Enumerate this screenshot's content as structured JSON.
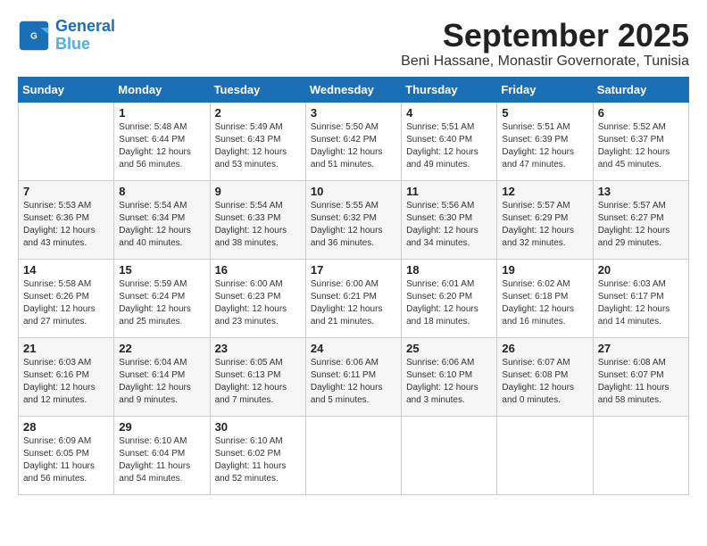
{
  "logo": {
    "line1": "General",
    "line2": "Blue"
  },
  "title": "September 2025",
  "location": "Beni Hassane, Monastir Governorate, Tunisia",
  "days_of_week": [
    "Sunday",
    "Monday",
    "Tuesday",
    "Wednesday",
    "Thursday",
    "Friday",
    "Saturday"
  ],
  "weeks": [
    [
      {
        "day": "",
        "text": ""
      },
      {
        "day": "1",
        "text": "Sunrise: 5:48 AM\nSunset: 6:44 PM\nDaylight: 12 hours\nand 56 minutes."
      },
      {
        "day": "2",
        "text": "Sunrise: 5:49 AM\nSunset: 6:43 PM\nDaylight: 12 hours\nand 53 minutes."
      },
      {
        "day": "3",
        "text": "Sunrise: 5:50 AM\nSunset: 6:42 PM\nDaylight: 12 hours\nand 51 minutes."
      },
      {
        "day": "4",
        "text": "Sunrise: 5:51 AM\nSunset: 6:40 PM\nDaylight: 12 hours\nand 49 minutes."
      },
      {
        "day": "5",
        "text": "Sunrise: 5:51 AM\nSunset: 6:39 PM\nDaylight: 12 hours\nand 47 minutes."
      },
      {
        "day": "6",
        "text": "Sunrise: 5:52 AM\nSunset: 6:37 PM\nDaylight: 12 hours\nand 45 minutes."
      }
    ],
    [
      {
        "day": "7",
        "text": "Sunrise: 5:53 AM\nSunset: 6:36 PM\nDaylight: 12 hours\nand 43 minutes."
      },
      {
        "day": "8",
        "text": "Sunrise: 5:54 AM\nSunset: 6:34 PM\nDaylight: 12 hours\nand 40 minutes."
      },
      {
        "day": "9",
        "text": "Sunrise: 5:54 AM\nSunset: 6:33 PM\nDaylight: 12 hours\nand 38 minutes."
      },
      {
        "day": "10",
        "text": "Sunrise: 5:55 AM\nSunset: 6:32 PM\nDaylight: 12 hours\nand 36 minutes."
      },
      {
        "day": "11",
        "text": "Sunrise: 5:56 AM\nSunset: 6:30 PM\nDaylight: 12 hours\nand 34 minutes."
      },
      {
        "day": "12",
        "text": "Sunrise: 5:57 AM\nSunset: 6:29 PM\nDaylight: 12 hours\nand 32 minutes."
      },
      {
        "day": "13",
        "text": "Sunrise: 5:57 AM\nSunset: 6:27 PM\nDaylight: 12 hours\nand 29 minutes."
      }
    ],
    [
      {
        "day": "14",
        "text": "Sunrise: 5:58 AM\nSunset: 6:26 PM\nDaylight: 12 hours\nand 27 minutes."
      },
      {
        "day": "15",
        "text": "Sunrise: 5:59 AM\nSunset: 6:24 PM\nDaylight: 12 hours\nand 25 minutes."
      },
      {
        "day": "16",
        "text": "Sunrise: 6:00 AM\nSunset: 6:23 PM\nDaylight: 12 hours\nand 23 minutes."
      },
      {
        "day": "17",
        "text": "Sunrise: 6:00 AM\nSunset: 6:21 PM\nDaylight: 12 hours\nand 21 minutes."
      },
      {
        "day": "18",
        "text": "Sunrise: 6:01 AM\nSunset: 6:20 PM\nDaylight: 12 hours\nand 18 minutes."
      },
      {
        "day": "19",
        "text": "Sunrise: 6:02 AM\nSunset: 6:18 PM\nDaylight: 12 hours\nand 16 minutes."
      },
      {
        "day": "20",
        "text": "Sunrise: 6:03 AM\nSunset: 6:17 PM\nDaylight: 12 hours\nand 14 minutes."
      }
    ],
    [
      {
        "day": "21",
        "text": "Sunrise: 6:03 AM\nSunset: 6:16 PM\nDaylight: 12 hours\nand 12 minutes."
      },
      {
        "day": "22",
        "text": "Sunrise: 6:04 AM\nSunset: 6:14 PM\nDaylight: 12 hours\nand 9 minutes."
      },
      {
        "day": "23",
        "text": "Sunrise: 6:05 AM\nSunset: 6:13 PM\nDaylight: 12 hours\nand 7 minutes."
      },
      {
        "day": "24",
        "text": "Sunrise: 6:06 AM\nSunset: 6:11 PM\nDaylight: 12 hours\nand 5 minutes."
      },
      {
        "day": "25",
        "text": "Sunrise: 6:06 AM\nSunset: 6:10 PM\nDaylight: 12 hours\nand 3 minutes."
      },
      {
        "day": "26",
        "text": "Sunrise: 6:07 AM\nSunset: 6:08 PM\nDaylight: 12 hours\nand 0 minutes."
      },
      {
        "day": "27",
        "text": "Sunrise: 6:08 AM\nSunset: 6:07 PM\nDaylight: 11 hours\nand 58 minutes."
      }
    ],
    [
      {
        "day": "28",
        "text": "Sunrise: 6:09 AM\nSunset: 6:05 PM\nDaylight: 11 hours\nand 56 minutes."
      },
      {
        "day": "29",
        "text": "Sunrise: 6:10 AM\nSunset: 6:04 PM\nDaylight: 11 hours\nand 54 minutes."
      },
      {
        "day": "30",
        "text": "Sunrise: 6:10 AM\nSunset: 6:02 PM\nDaylight: 11 hours\nand 52 minutes."
      },
      {
        "day": "",
        "text": ""
      },
      {
        "day": "",
        "text": ""
      },
      {
        "day": "",
        "text": ""
      },
      {
        "day": "",
        "text": ""
      }
    ]
  ]
}
